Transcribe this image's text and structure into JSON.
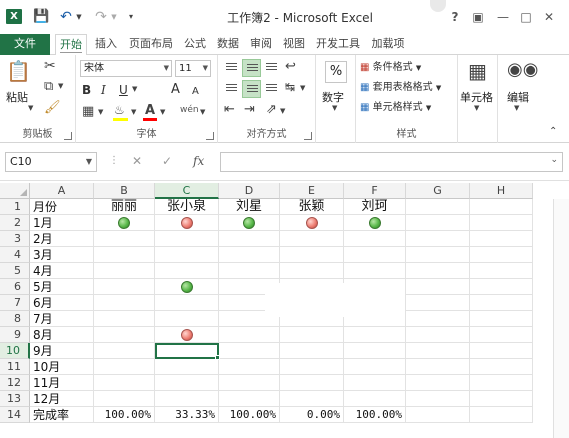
{
  "window": {
    "title": "工作簿2 - Microsoft Excel",
    "help": "?",
    "logo_letter": "X"
  },
  "quick_access": {
    "save_icon": "save-icon",
    "undo_icon": "undo-icon",
    "redo_icon": "redo-icon"
  },
  "tabs": [
    {
      "label": "文件"
    },
    {
      "label": "开始"
    },
    {
      "label": "插入"
    },
    {
      "label": "页面布局"
    },
    {
      "label": "公式"
    },
    {
      "label": "数据"
    },
    {
      "label": "审阅"
    },
    {
      "label": "视图"
    },
    {
      "label": "开发工具"
    },
    {
      "label": "加载项"
    }
  ],
  "ribbon": {
    "clipboard": {
      "paste": "粘贴",
      "label": "剪贴板"
    },
    "font": {
      "name": "宋体",
      "size": "11",
      "bold": "B",
      "italic": "I",
      "underline": "U",
      "grow": "A",
      "shrink": "A",
      "wen": "wén",
      "label": "字体",
      "fill_color": "#ffff00",
      "font_color": "#ff0000"
    },
    "alignment": {
      "label": "对齐方式"
    },
    "number": {
      "percent": "%",
      "label": "数字"
    },
    "styles": {
      "conditional": "条件格式",
      "table": "套用表格格式",
      "cell_styles": "单元格样式",
      "label": "样式"
    },
    "cells": {
      "label": "单元格"
    },
    "editing": {
      "label": "编辑"
    }
  },
  "formula_bar": {
    "name_box": "C10",
    "cancel": "✕",
    "enter": "✓",
    "fx": "fx",
    "value": ""
  },
  "sheet": {
    "columns": [
      "A",
      "B",
      "C",
      "D",
      "E",
      "F",
      "G",
      "H"
    ],
    "selected_column": "C",
    "selected_row": "10",
    "active_cell": "C10",
    "rows": [
      {
        "n": "1",
        "A": "月份",
        "B": "丽丽",
        "C": "张小泉",
        "D": "刘星",
        "E": "张颖",
        "F": "刘珂"
      },
      {
        "n": "2",
        "A": "1月",
        "B": "green",
        "C": "red",
        "D": "green",
        "E": "red",
        "F": "green"
      },
      {
        "n": "3",
        "A": "2月"
      },
      {
        "n": "4",
        "A": "3月"
      },
      {
        "n": "5",
        "A": "4月"
      },
      {
        "n": "6",
        "A": "5月",
        "C": "green"
      },
      {
        "n": "7",
        "A": "6月"
      },
      {
        "n": "8",
        "A": "7月"
      },
      {
        "n": "9",
        "A": "8月",
        "C": "red"
      },
      {
        "n": "10",
        "A": "9月"
      },
      {
        "n": "11",
        "A": "10月"
      },
      {
        "n": "12",
        "A": "11月"
      },
      {
        "n": "13",
        "A": "12月"
      },
      {
        "n": "14",
        "A": "完成率",
        "B": "100.00%",
        "C": "33.33%",
        "D": "100.00%",
        "E": "0.00%",
        "F": "100.00%"
      }
    ],
    "colors": {
      "selection": "#217346",
      "green_light": "#59b84a",
      "red_light": "#ee7f74"
    }
  }
}
